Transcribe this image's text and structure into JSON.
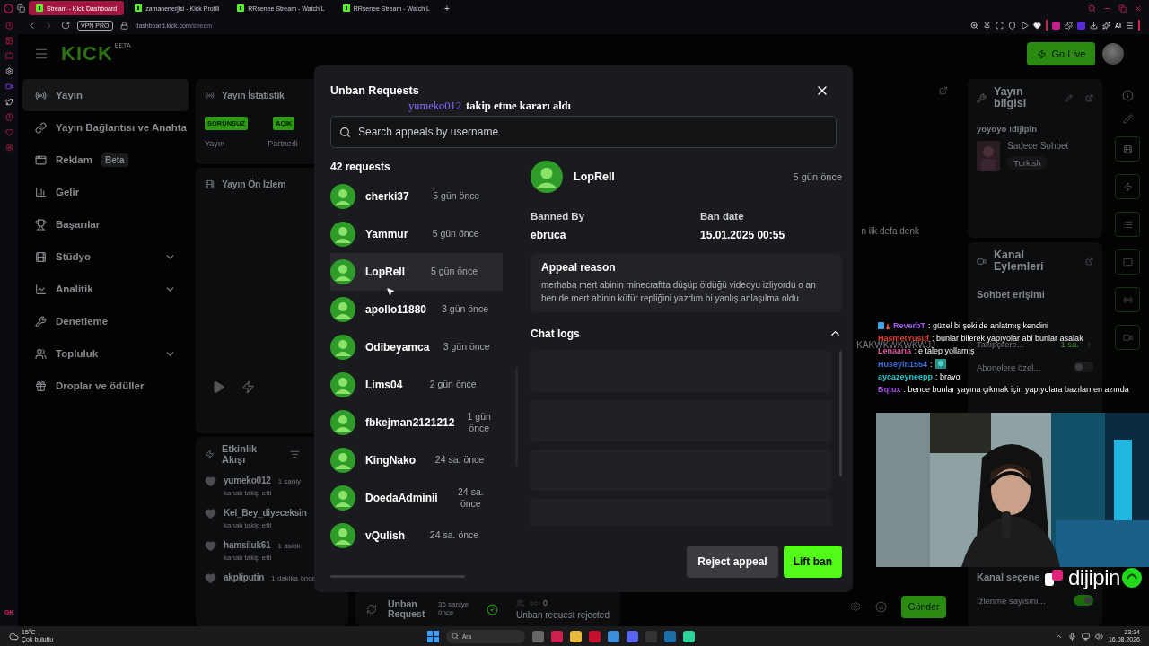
{
  "browser": {
    "tabs": [
      {
        "title": "Stream - Kick Dashboard",
        "selected": true
      },
      {
        "title": "zamanenerjisi - Kick Profili",
        "selected": false
      },
      {
        "title": "RRsenee Stream - Watch L",
        "selected": false
      },
      {
        "title": "RRsenee Stream - Watch L",
        "selected": false
      }
    ],
    "new_tab": "+",
    "vpn_badge": "VPN PRO",
    "url_host": "dashboard.kick.com",
    "url_path": "/stream",
    "ai_label": "AI",
    "strip_footer": "GK"
  },
  "header": {
    "logo": "KICK",
    "logo_badge": "BETA",
    "go_live": "Go Live"
  },
  "sidebar": {
    "items": [
      {
        "label": "Yayın",
        "selected": true,
        "has_submenu": false
      },
      {
        "label": "Yayın Bağlantısı ve Anahta",
        "selected": false,
        "has_submenu": false
      },
      {
        "label": "Reklam",
        "badge": "Beta",
        "selected": false,
        "has_submenu": false
      },
      {
        "label": "Gelir",
        "selected": false,
        "has_submenu": false
      },
      {
        "label": "Başarılar",
        "selected": false,
        "has_submenu": false
      },
      {
        "label": "Stüdyo",
        "selected": false,
        "has_submenu": true
      },
      {
        "label": "Analitik",
        "selected": false,
        "has_submenu": true
      },
      {
        "label": "Denetleme",
        "selected": false,
        "has_submenu": false
      },
      {
        "label": "Topluluk",
        "selected": false,
        "has_submenu": true
      },
      {
        "label": "Droplar ve ödüller",
        "selected": false,
        "has_submenu": false
      }
    ]
  },
  "stats_panel": {
    "title": "Yayın İstatistik",
    "badges": [
      "SORUNSUZ",
      "AÇIK"
    ],
    "labels": [
      "Yayın",
      "Partnerli"
    ]
  },
  "preview_panel": {
    "title": "Yayın Ön İzlem"
  },
  "activity_panel": {
    "title": "Etkinlik Akışı",
    "events": [
      {
        "user": "yumeko012",
        "time": "1 saniy",
        "action": "kanalı takip etti"
      },
      {
        "user": "Kel_Bey_diyeceksin",
        "action": "kanalı takip etti"
      },
      {
        "user": "hamsiluk61",
        "time": "1 dakik",
        "action": "kanalı takip etti"
      },
      {
        "user": "akpliputin",
        "time": "1 dakika önce"
      }
    ]
  },
  "chat_panel": {
    "messages": [
      "n ilk defa denk",
      "KAKWKWKWKWJJ"
    ],
    "mod_action": {
      "title": "Unban Request",
      "time": "35 saniye önce",
      "count": "0",
      "status": "Unban request rejected"
    },
    "send": "Gönder"
  },
  "stream_info": {
    "title": "Yayın bilgisi",
    "stream_title": "yoyoyo !dijipin",
    "category": "Sadece Sohbet",
    "tag": "Turkish"
  },
  "channel_actions": {
    "title": "Kanal Eylemleri",
    "section": "Sohbet erişimi",
    "rows": [
      {
        "kind": "link",
        "label": "Takipçilere...",
        "value": "1 sa."
      },
      {
        "kind": "toggle",
        "label": "Abonelere özel...",
        "on": false
      }
    ],
    "section_2": "Kanal seçene",
    "rows_2": [
      {
        "kind": "toggle",
        "label": "İzlenme sayısını...",
        "on": true
      }
    ]
  },
  "notification": {
    "user": "yumeko012",
    "text": "takip etme kararı aldı"
  },
  "modal": {
    "title": "Unban Requests",
    "search": {
      "placeholder": "Search appeals by username"
    },
    "count": "42 requests",
    "requests": [
      {
        "username": "cherki37",
        "time": "5 gün önce",
        "selected": false
      },
      {
        "username": "Yammur",
        "time": "5 gün önce",
        "selected": false
      },
      {
        "username": "LopRell",
        "time": "5 gün önce",
        "selected": true
      },
      {
        "username": "apollo11880",
        "time": "3 gün önce",
        "selected": false
      },
      {
        "username": "Odibeyamca",
        "time": "3 gün önce",
        "selected": false
      },
      {
        "username": "Lims04",
        "time": "2 gün önce",
        "selected": false
      },
      {
        "username": "fbkejman2121212",
        "time": "1 gün önce",
        "selected": false
      },
      {
        "username": "KingNako",
        "time": "24 sa. önce",
        "selected": false
      },
      {
        "username": "DoedaAdminii",
        "time": "24 sa. önce",
        "selected": false
      },
      {
        "username": "vQulish",
        "time": "24 sa. önce",
        "selected": false
      }
    ],
    "detail": {
      "username": "LopRell",
      "time": "5 gün önce",
      "banned_by_label": "Banned By",
      "banned_by": "ebruca",
      "ban_date_label": "Ban date",
      "ban_date": "15.01.2025 00:55",
      "appeal_label": "Appeal reason",
      "appeal_text": "merhaba mert abinin minecraftta düşüp öldüğü videoyu izliyordu o an ben de mert abinin küfür repliğini yazdım bi yanlış anlaşılma oldu",
      "chat_logs": {
        "title": "Chat logs",
        "expanded": true
      }
    },
    "reject": "Reject appeal",
    "lift": "Lift ban"
  },
  "chat_overlay": [
    {
      "name": "ReverbT",
      "color": "#a35cf0",
      "badges": true,
      "text": ": güzel bi şekilde anlatmış kendini",
      "emote": false
    },
    {
      "name": "HasmetYusuf",
      "color": "#e5412c",
      "badges": false,
      "text": ": bunlar bilerek yapıyolar abi bunlar asalak",
      "emote": false
    },
    {
      "name": "Lenaaria",
      "color": "#e0559a",
      "badges": false,
      "text": ": e talep yollamış",
      "emote": false
    },
    {
      "name": "Huseyin1554",
      "color": "#3f6fd8",
      "badges": false,
      "text": ":",
      "emote": true
    },
    {
      "name": "aycazeyneepp",
      "color": "#22c8d0",
      "badges": false,
      "text": ": bravo",
      "emote": false
    },
    {
      "name": "Bqtux",
      "color": "#a44fe2",
      "badges": false,
      "text": ": bence bunlar yayına çıkmak için yapıyolara bazıları en azında",
      "emote": false
    }
  ],
  "brand": {
    "logo": "dijipin"
  },
  "taskbar": {
    "temp": "15°C",
    "weather": "Çok bulutlu",
    "search": "Ara",
    "time": "23:34",
    "date": "16.08.2026"
  }
}
